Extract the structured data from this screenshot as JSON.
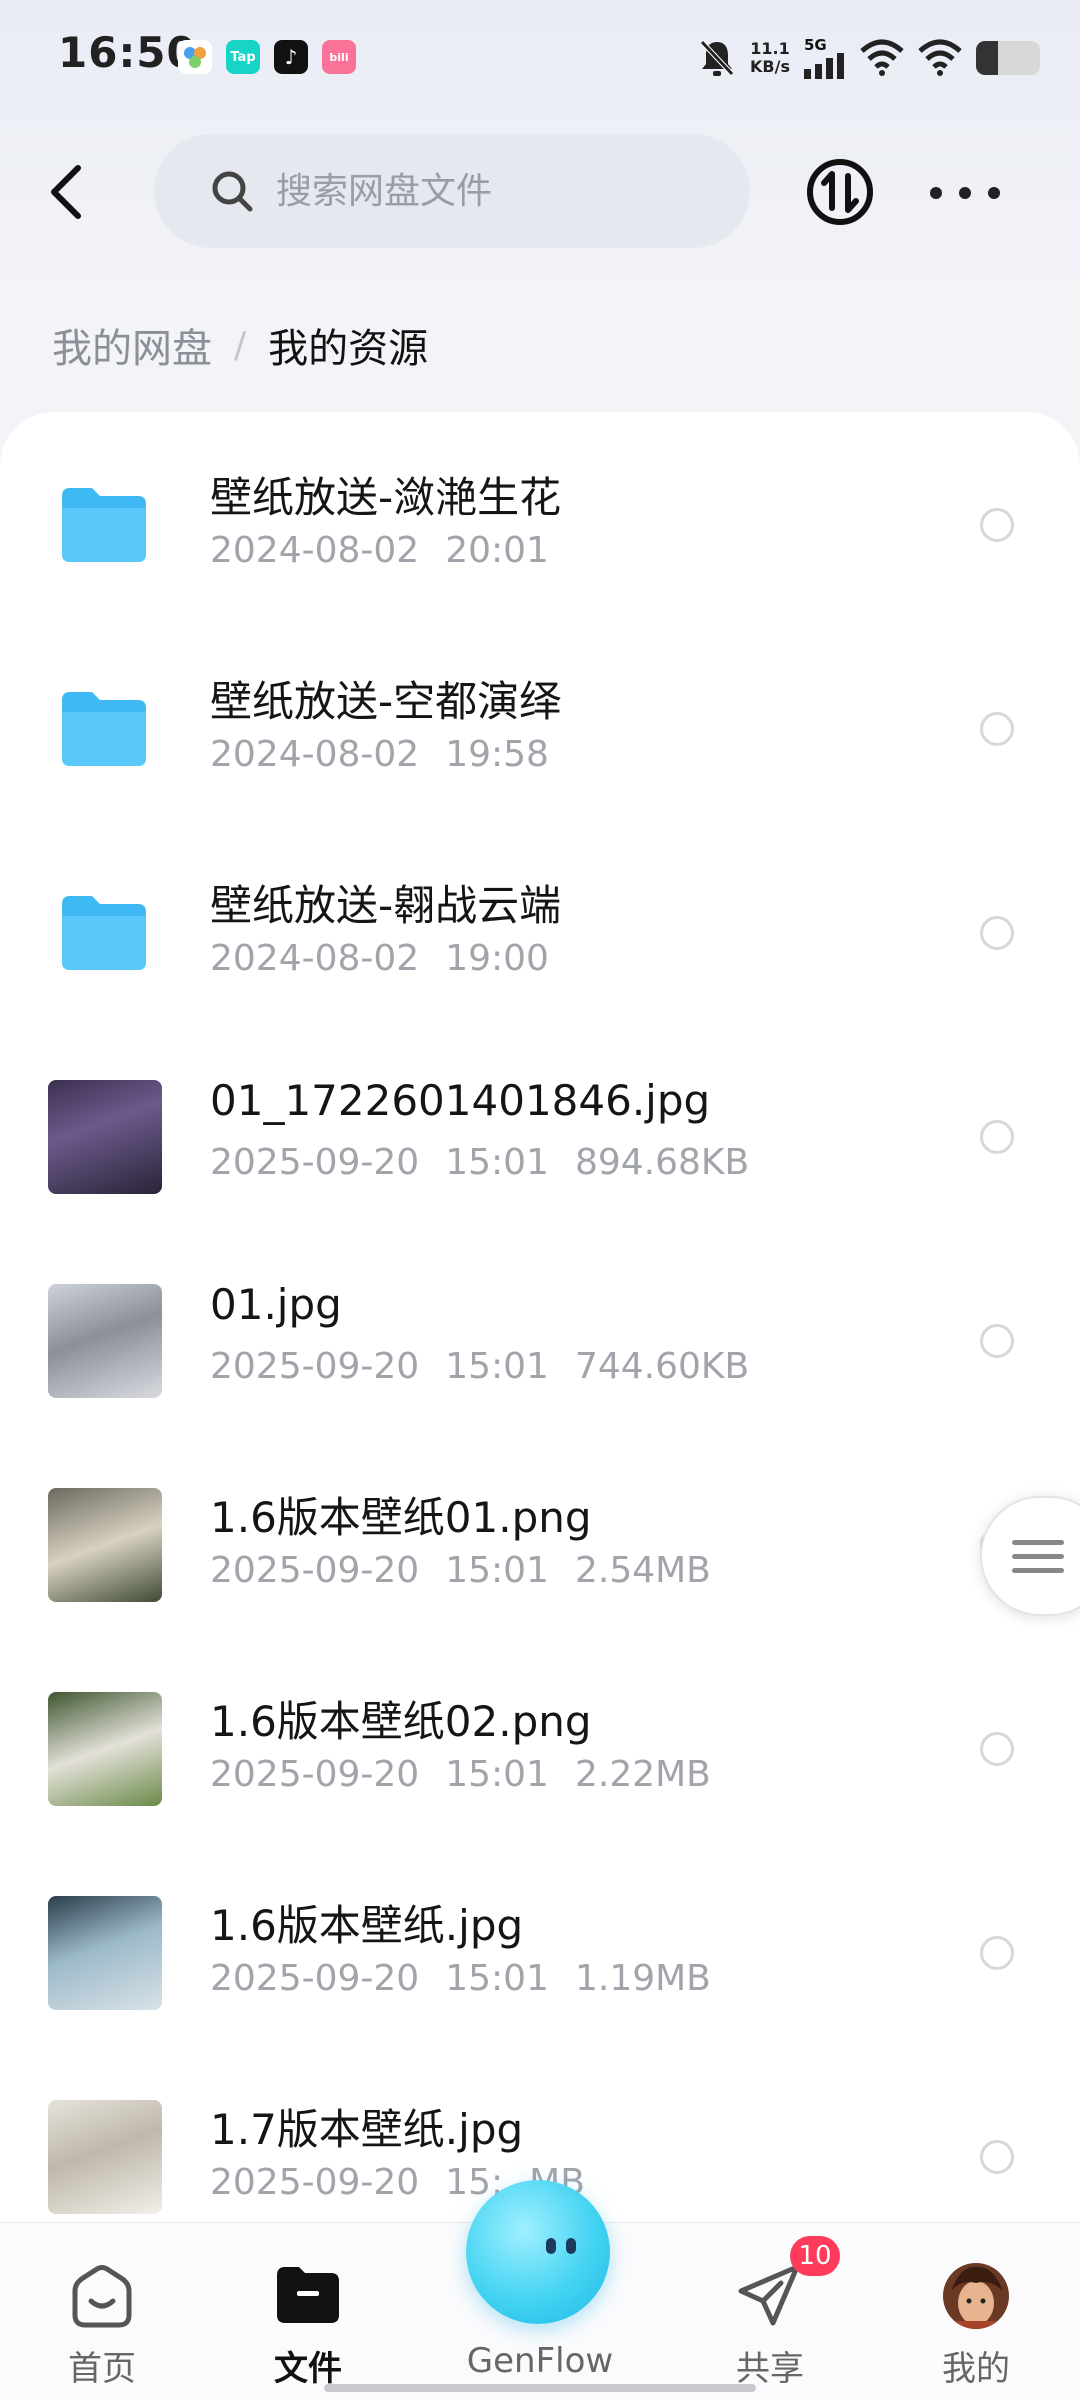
{
  "status_bar": {
    "time": "16:50",
    "apps": [
      {
        "icon": "hexagon-app-icon",
        "label": "",
        "color": "#ffffff"
      },
      {
        "icon": "taptap-icon",
        "label": "Tap",
        "color": "#18d4c6"
      },
      {
        "icon": "tiktok-icon",
        "label": "♪",
        "color": "#111111"
      },
      {
        "icon": "bilibili-icon",
        "label": "bili",
        "color": "#fb7299"
      }
    ],
    "net_speed": "11.1",
    "net_unit": "KB/s",
    "signal_label": "5G",
    "battery_level": 0.35
  },
  "header": {
    "search_placeholder": "搜索网盘文件"
  },
  "breadcrumb": {
    "root": "我的网盘",
    "separator": "/",
    "current": "我的资源"
  },
  "files": [
    {
      "type": "folder",
      "name": "壁纸放送-潋滟生花",
      "date": "2024-08-02",
      "time": "20:01",
      "size": ""
    },
    {
      "type": "folder",
      "name": "壁纸放送-空都演绎",
      "date": "2024-08-02",
      "time": "19:58",
      "size": ""
    },
    {
      "type": "folder",
      "name": "壁纸放送-翱战云端",
      "date": "2024-08-02",
      "time": "19:00",
      "size": ""
    },
    {
      "type": "image",
      "name": "01_1722601401846.jpg",
      "date": "2025-09-20",
      "time": "15:01",
      "size": "894.68KB"
    },
    {
      "type": "image",
      "name": "01.jpg",
      "date": "2025-09-20",
      "time": "15:01",
      "size": "744.60KB"
    },
    {
      "type": "image",
      "name": "1.6版本壁纸01.png",
      "date": "2025-09-20",
      "time": "15:01",
      "size": "2.54MB"
    },
    {
      "type": "image",
      "name": "1.6版本壁纸02.png",
      "date": "2025-09-20",
      "time": "15:01",
      "size": "2.22MB"
    },
    {
      "type": "image",
      "name": "1.6版本壁纸.jpg",
      "date": "2025-09-20",
      "time": "15:01",
      "size": "1.19MB"
    },
    {
      "type": "image",
      "name": "1.7版本壁纸.jpg",
      "date": "2025-09-20",
      "time": "15:",
      "size": "MB"
    }
  ],
  "bottom_nav": {
    "home": "首页",
    "files": "文件",
    "genflow": "GenFlow",
    "share": "共享",
    "share_badge": "10",
    "mine": "我的"
  },
  "colors": {
    "folder": "#3fb9f3",
    "accent": "#111111",
    "badge": "#ff3b5c"
  }
}
